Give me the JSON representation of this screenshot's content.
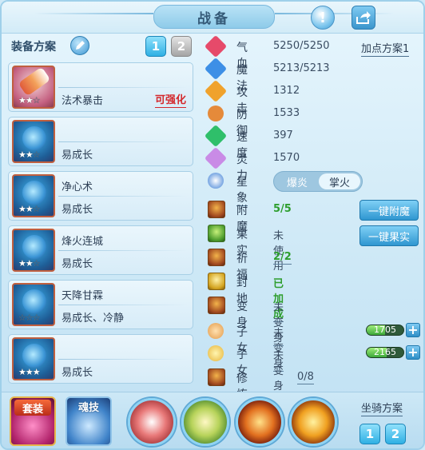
{
  "title": "战备",
  "left": {
    "sets_label": "装备方案",
    "set_buttons": [
      "1",
      "2"
    ],
    "slots": [
      {
        "skill": "法术暴击",
        "trait": "",
        "upgrade": "可强化",
        "stars_on": "★★",
        "stars_off": "☆"
      },
      {
        "skill": "",
        "trait": "易成长",
        "upgrade": "",
        "stars_on": "★★",
        "stars_off": "☆"
      },
      {
        "skill": "净心术",
        "trait": "易成长",
        "upgrade": "",
        "stars_on": "★★",
        "stars_off": "☆"
      },
      {
        "skill": "烽火连城",
        "trait": "易成长",
        "upgrade": "",
        "stars_on": "★★",
        "stars_off": "☆"
      },
      {
        "skill": "天降甘霖",
        "trait": "易成长、冷静",
        "upgrade": "",
        "stars_on": "",
        "stars_off": "☆☆☆"
      },
      {
        "skill": "",
        "trait": "易成长",
        "upgrade": "",
        "stars_on": "★★★",
        "stars_off": ""
      }
    ]
  },
  "stats": [
    {
      "label": "气血",
      "value": "5250/5250",
      "color": "#e64a6a",
      "icon": "heart-icon"
    },
    {
      "label": "魔法",
      "value": "5213/5213",
      "color": "#3d8fe6",
      "icon": "mana-icon"
    },
    {
      "label": "攻击",
      "value": "1312",
      "color": "#f0a22c",
      "icon": "attack-icon"
    },
    {
      "label": "防御",
      "value": "1533",
      "color": "#e58a3a",
      "icon": "defense-icon"
    },
    {
      "label": "速度",
      "value": "397",
      "color": "#2fbf6a",
      "icon": "speed-icon"
    },
    {
      "label": "灵力",
      "value": "1570",
      "color": "#c98be6",
      "icon": "spirit-icon"
    }
  ],
  "add_point": "加点方案1",
  "star_sign": {
    "label": "星象",
    "options": [
      "爆炎",
      "掌火"
    ],
    "selected": "掌火"
  },
  "features": [
    {
      "label": "附魔",
      "value": "5/5",
      "style": "green"
    },
    {
      "label": "果实",
      "value": "未使用",
      "style": "plain"
    },
    {
      "label": "祈福",
      "value": "2/2",
      "style": "green"
    },
    {
      "label": "封地",
      "value": "已加成",
      "style": "green"
    },
    {
      "label": "变身",
      "value": "未变身",
      "style": "normal"
    },
    {
      "label": "子女",
      "value": "未变身",
      "style": "normal"
    },
    {
      "label": "子女",
      "value": "未变身",
      "style": "normal"
    },
    {
      "label": "修炼觉醒",
      "value": "0/8",
      "style": "normal"
    }
  ],
  "buttons": {
    "enchant": "一键附魔",
    "fruit": "一键果实"
  },
  "bars": [
    {
      "text": "1705",
      "fill": 0.5
    },
    {
      "text": "2165",
      "fill": 0.55
    }
  ],
  "bottom": {
    "suit": "套装",
    "soul": "魂技",
    "mount": "坐骑方案",
    "mount_buttons": [
      "1",
      "2"
    ]
  }
}
